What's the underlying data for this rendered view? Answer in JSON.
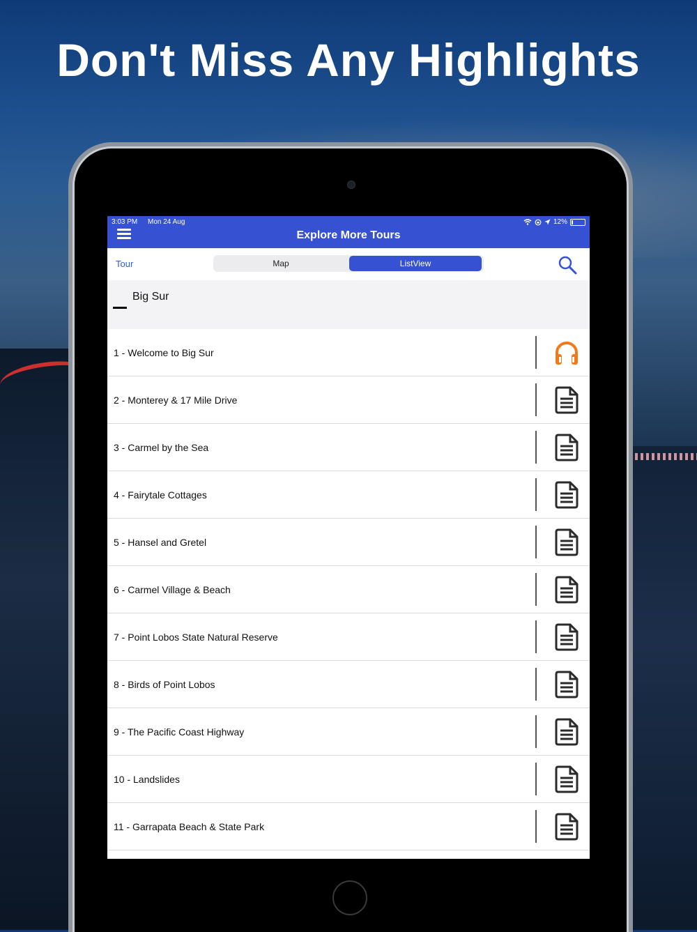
{
  "headline": "Don't Miss Any Highlights",
  "status": {
    "time": "3:03 PM",
    "date": "Mon 24 Aug",
    "battery": "12%"
  },
  "navbar": {
    "title": "Explore More Tours",
    "menu_icon": "hamburger-menu-icon"
  },
  "toolbar": {
    "tour_label": "Tour",
    "segments": [
      "Map",
      "ListView"
    ],
    "selected_segment": "ListView",
    "search_icon": "search-icon"
  },
  "section": {
    "title": "Big Sur"
  },
  "colors": {
    "brand": "#3652d3",
    "audio_icon": "#f07a1a",
    "doc_icon": "#2b2b2b"
  },
  "tour_stops": [
    {
      "label": "1 - Welcome to Big Sur",
      "icon": "headphones-icon"
    },
    {
      "label": "2 - Monterey & 17 Mile Drive",
      "icon": "document-icon"
    },
    {
      "label": "3 - Carmel by the Sea",
      "icon": "document-icon"
    },
    {
      "label": "4 - Fairytale Cottages",
      "icon": "document-icon"
    },
    {
      "label": "5 - Hansel and Gretel",
      "icon": "document-icon"
    },
    {
      "label": "6 - Carmel Village & Beach",
      "icon": "document-icon"
    },
    {
      "label": "7 - Point Lobos State Natural Reserve",
      "icon": "document-icon"
    },
    {
      "label": "8 - Birds of Point Lobos",
      "icon": "document-icon"
    },
    {
      "label": "9 - The Pacific Coast Highway",
      "icon": "document-icon"
    },
    {
      "label": "10 - Landslides",
      "icon": "document-icon"
    },
    {
      "label": "11 - Garrapata Beach & State Park",
      "icon": "document-icon"
    }
  ]
}
